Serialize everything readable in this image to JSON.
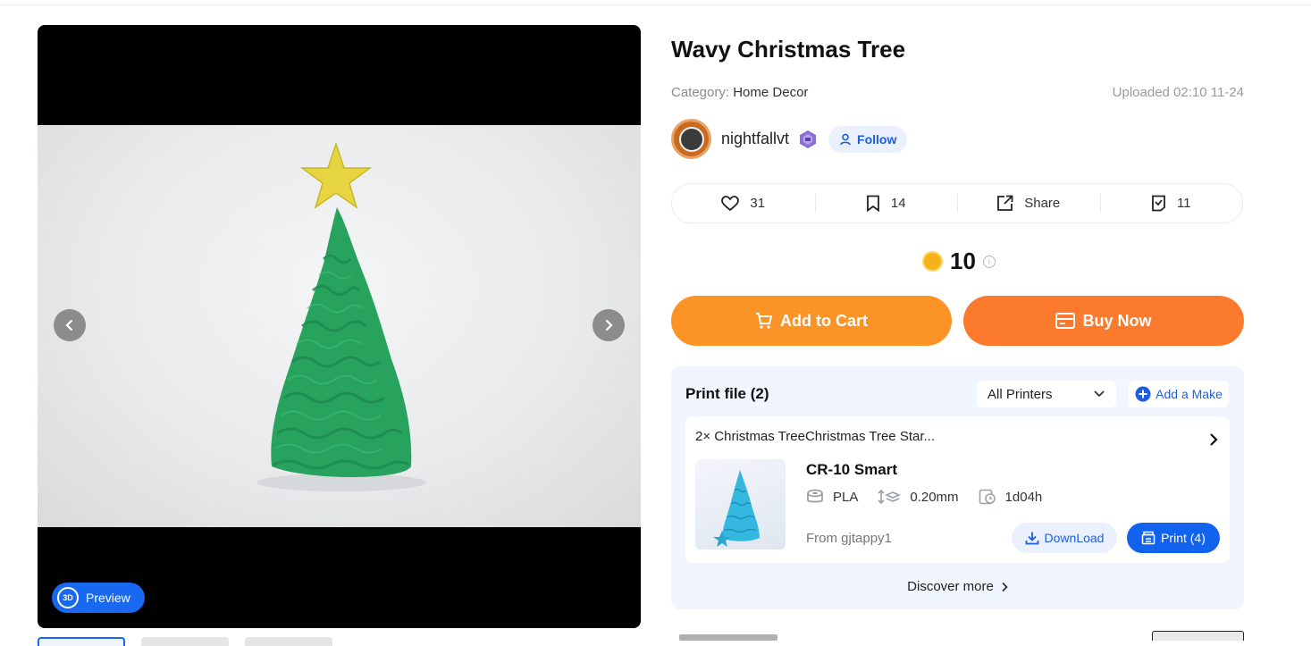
{
  "product": {
    "title": "Wavy Christmas Tree",
    "category_label": "Category:",
    "category_value": "Home Decor",
    "uploaded": "Uploaded 02:10 11-24"
  },
  "author": {
    "name": "nightfallvt",
    "follow_label": "Follow"
  },
  "stats": {
    "likes": "31",
    "collects": "14",
    "share_label": "Share",
    "makes": "11"
  },
  "price": {
    "value": "10",
    "info": "i"
  },
  "actions": {
    "add_to_cart": "Add to Cart",
    "buy_now": "Buy Now"
  },
  "gallery": {
    "preview_label": "Preview",
    "badge_3d": "3D"
  },
  "print_files": {
    "title": "Print file (2)",
    "printer_filter": "All Printers",
    "add_make": "Add a Make",
    "file": {
      "name": "2× Christmas TreeChristmas Tree Star...",
      "machine": "CR-10 Smart",
      "material": "PLA",
      "layer_height": "0.20mm",
      "print_time": "1d04h",
      "from": "From gjtappy1",
      "download_label": "DownLoad",
      "print_label": "Print  (4)"
    },
    "discover_more": "Discover more"
  },
  "colors": {
    "accent_blue": "#1162ee",
    "cart_orange": "#fb9327",
    "buy_orange": "#fb7a2e",
    "tree_green": "#27a35e",
    "star_yellow": "#e6d440"
  }
}
